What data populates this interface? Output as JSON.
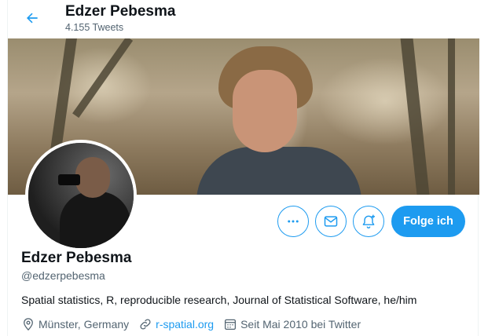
{
  "header": {
    "title": "Edzer Pebesma",
    "tweet_count": "4.155 Tweets"
  },
  "profile": {
    "name": "Edzer Pebesma",
    "handle": "@edzerpebesma",
    "bio": "Spatial statistics, R, reproducible research, Journal of Statistical Software, he/him",
    "location": "Münster, Germany",
    "website": "r-spatial.org",
    "joined": "Seit Mai 2010 bei Twitter"
  },
  "actions": {
    "follow_label": "Folge ich"
  },
  "icons": {
    "back": "arrow-left-icon",
    "more": "more-horizontal-icon",
    "mail": "mail-icon",
    "notify": "bell-plus-icon",
    "location": "location-pin-icon",
    "link": "link-icon",
    "calendar": "calendar-icon"
  },
  "colors": {
    "accent": "#1d9bf0",
    "text": "#0f1419",
    "secondary_text": "#536471"
  }
}
